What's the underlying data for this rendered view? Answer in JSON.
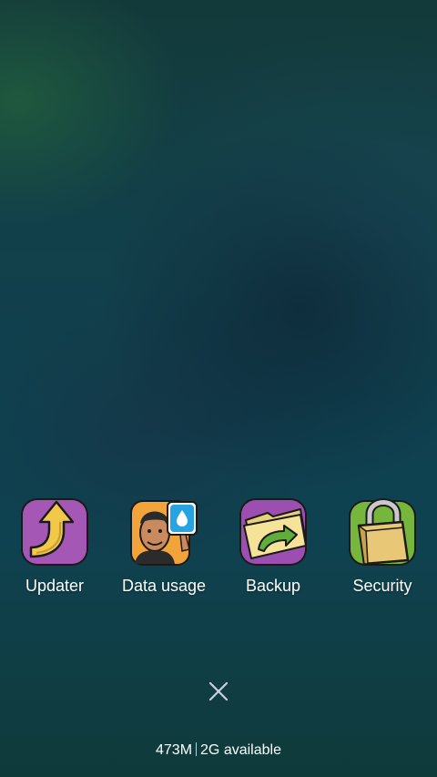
{
  "apps": [
    {
      "label": "Updater",
      "icon": "updater-arrow-icon"
    },
    {
      "label": "Data usage",
      "icon": "data-usage-icon"
    },
    {
      "label": "Backup",
      "icon": "backup-folder-icon"
    },
    {
      "label": "Security",
      "icon": "security-lock-icon"
    }
  ],
  "close": {
    "icon": "close-icon"
  },
  "storage": {
    "free": "473M",
    "total": "2G available"
  },
  "colors": {
    "updater_bg": "#a457b4",
    "updater_arrow": "#f2c84b",
    "data_usage_badge": "#26a3e0",
    "backup_bg": "#9c4fb0",
    "backup_folder": "#f6e39a",
    "backup_arrow": "#5fae3a",
    "security_bg": "#76b63c",
    "security_lock": "#e8c877"
  }
}
